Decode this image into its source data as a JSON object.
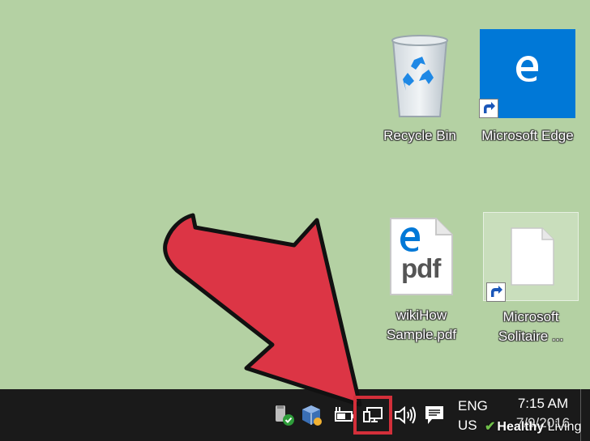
{
  "desktop_icons": {
    "recycle_bin": {
      "label": "Recycle Bin",
      "icon": "recycle-bin-icon"
    },
    "microsoft_edge": {
      "label": "Microsoft Edge",
      "icon": "edge-icon",
      "tile_color": "#0078d7"
    },
    "wikihow_pdf": {
      "label_line1": "wikiHow",
      "label_line2": "Sample.pdf",
      "doc_text": "pdf",
      "icon": "pdf-document-icon"
    },
    "solitaire": {
      "label_line1": "Microsoft",
      "label_line2": "Solitaire ...",
      "icon": "blank-document-icon"
    }
  },
  "annotation": {
    "arrow": "red-pointer-arrow",
    "highlight_color": "#d32f3a"
  },
  "taskbar": {
    "background": "#1a1a1a",
    "tray_icons": [
      "usb-eject-icon",
      "virtualbox-icon",
      "power-battery-icon",
      "network-wired-icon",
      "volume-icon",
      "action-center-icon"
    ],
    "language": {
      "line1": "ENG",
      "line2": "US"
    },
    "clock": {
      "time": "7:15 AM",
      "date": "7/9/2016"
    }
  },
  "watermark": {
    "bold": "Healthy",
    "light": "Living"
  },
  "colors": {
    "desktop_background": "#b4d1a3",
    "edge_blue": "#0078d7",
    "arrow_red": "#dc3545"
  }
}
